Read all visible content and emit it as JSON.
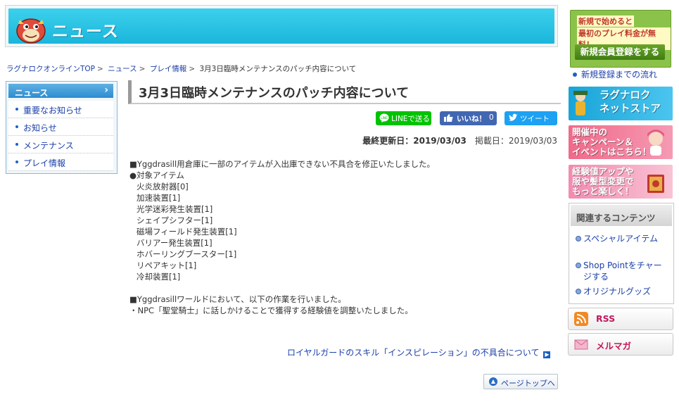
{
  "banner": {
    "title": "ニュース"
  },
  "breadcrumb": {
    "items": [
      "ラグナロクオンラインTOP",
      "ニュース",
      "プレイ情報"
    ],
    "current": "3月3日臨時メンテナンスのパッチ内容について",
    "separator": ">"
  },
  "leftnav": {
    "header": "ニュース",
    "items": [
      "重要なお知らせ",
      "お知らせ",
      "メンテナンス",
      "プレイ情報"
    ]
  },
  "article": {
    "title": "3月3日臨時メンテナンスのパッチ内容について",
    "updated": "最終更新日：2019/03/03",
    "published": "掲載日：2019/03/03",
    "lines": [
      "■Yggdrasill用倉庫に一部のアイテムが入出庫できない不具合を修正いたしました。",
      "●対象アイテム",
      "火炎放射器[0]",
      "加速装置[1]",
      "光学迷彩発生装置[1]",
      "シェイプシフター[1]",
      "磁場フィールド発生装置[1]",
      "バリアー発生装置[1]",
      "ホバーリングブースター[1]",
      "リペアキット[1]",
      "冷却装置[1]",
      "",
      "■Yggdrasillワールドにおいて、以下の作業を行いました。",
      "・NPC「聖堂騎士」に話しかけることで獲得する経験値を調整いたしました。"
    ],
    "next_link": "ロイヤルガードのスキル「インスピレーション」の不具合について",
    "page_top": "ページトップへ"
  },
  "share": {
    "line": "LINEで送る",
    "like": "いいね！",
    "like_count": "0",
    "tweet": "ツイート"
  },
  "sidebar": {
    "register": {
      "sub1": "新規で始めると",
      "sub2": "最初のプレイ料金が無料！",
      "main": "新規会員登録をする",
      "flow_link": "新規登録までの流れ"
    },
    "banners": {
      "store": [
        "ラグナロク",
        "ネットストア"
      ],
      "campaign": [
        "開催中の",
        "キャンペーン＆",
        "イベントはこちら！"
      ],
      "exp": [
        "経験値アップや",
        "服や髪型変更で",
        "もっと楽しく！"
      ]
    },
    "related": {
      "header": "関連するコンテンツ",
      "items": [
        "スペシャルアイテム",
        "Shop Pointをチャージする",
        "オリジナルグッズ"
      ]
    },
    "rss": "RSS",
    "mail": "メルマガ"
  },
  "colors": {
    "banner": "#1bb6dc",
    "link": "#1a3fa8",
    "line_green": "#00c300",
    "facebook": "#4267b2",
    "twitter": "#1da1f2",
    "register_green": "#8bc34a"
  }
}
